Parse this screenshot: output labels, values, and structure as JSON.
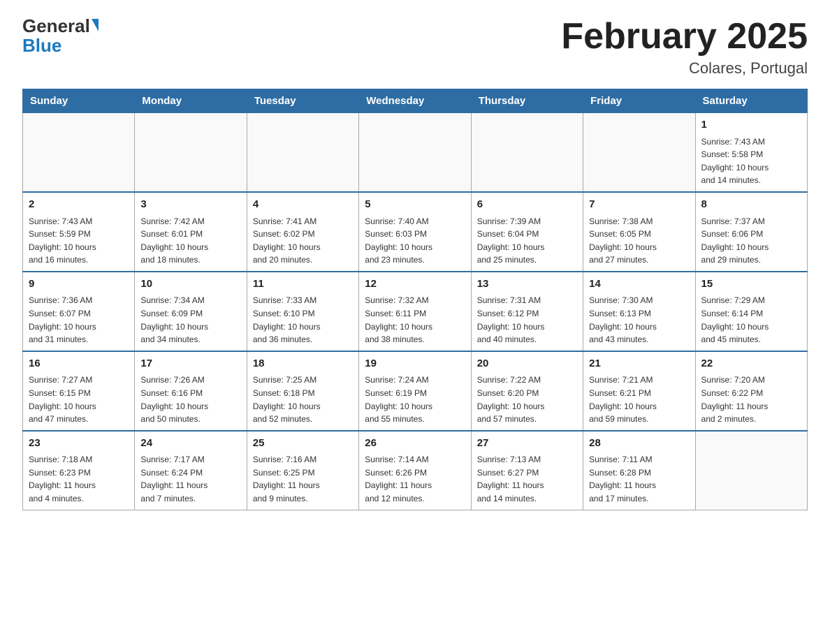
{
  "logo": {
    "general": "General",
    "blue": "Blue"
  },
  "header": {
    "title": "February 2025",
    "location": "Colares, Portugal"
  },
  "weekdays": [
    "Sunday",
    "Monday",
    "Tuesday",
    "Wednesday",
    "Thursday",
    "Friday",
    "Saturday"
  ],
  "weeks": [
    [
      {
        "day": "",
        "info": ""
      },
      {
        "day": "",
        "info": ""
      },
      {
        "day": "",
        "info": ""
      },
      {
        "day": "",
        "info": ""
      },
      {
        "day": "",
        "info": ""
      },
      {
        "day": "",
        "info": ""
      },
      {
        "day": "1",
        "info": "Sunrise: 7:43 AM\nSunset: 5:58 PM\nDaylight: 10 hours\nand 14 minutes."
      }
    ],
    [
      {
        "day": "2",
        "info": "Sunrise: 7:43 AM\nSunset: 5:59 PM\nDaylight: 10 hours\nand 16 minutes."
      },
      {
        "day": "3",
        "info": "Sunrise: 7:42 AM\nSunset: 6:01 PM\nDaylight: 10 hours\nand 18 minutes."
      },
      {
        "day": "4",
        "info": "Sunrise: 7:41 AM\nSunset: 6:02 PM\nDaylight: 10 hours\nand 20 minutes."
      },
      {
        "day": "5",
        "info": "Sunrise: 7:40 AM\nSunset: 6:03 PM\nDaylight: 10 hours\nand 23 minutes."
      },
      {
        "day": "6",
        "info": "Sunrise: 7:39 AM\nSunset: 6:04 PM\nDaylight: 10 hours\nand 25 minutes."
      },
      {
        "day": "7",
        "info": "Sunrise: 7:38 AM\nSunset: 6:05 PM\nDaylight: 10 hours\nand 27 minutes."
      },
      {
        "day": "8",
        "info": "Sunrise: 7:37 AM\nSunset: 6:06 PM\nDaylight: 10 hours\nand 29 minutes."
      }
    ],
    [
      {
        "day": "9",
        "info": "Sunrise: 7:36 AM\nSunset: 6:07 PM\nDaylight: 10 hours\nand 31 minutes."
      },
      {
        "day": "10",
        "info": "Sunrise: 7:34 AM\nSunset: 6:09 PM\nDaylight: 10 hours\nand 34 minutes."
      },
      {
        "day": "11",
        "info": "Sunrise: 7:33 AM\nSunset: 6:10 PM\nDaylight: 10 hours\nand 36 minutes."
      },
      {
        "day": "12",
        "info": "Sunrise: 7:32 AM\nSunset: 6:11 PM\nDaylight: 10 hours\nand 38 minutes."
      },
      {
        "day": "13",
        "info": "Sunrise: 7:31 AM\nSunset: 6:12 PM\nDaylight: 10 hours\nand 40 minutes."
      },
      {
        "day": "14",
        "info": "Sunrise: 7:30 AM\nSunset: 6:13 PM\nDaylight: 10 hours\nand 43 minutes."
      },
      {
        "day": "15",
        "info": "Sunrise: 7:29 AM\nSunset: 6:14 PM\nDaylight: 10 hours\nand 45 minutes."
      }
    ],
    [
      {
        "day": "16",
        "info": "Sunrise: 7:27 AM\nSunset: 6:15 PM\nDaylight: 10 hours\nand 47 minutes."
      },
      {
        "day": "17",
        "info": "Sunrise: 7:26 AM\nSunset: 6:16 PM\nDaylight: 10 hours\nand 50 minutes."
      },
      {
        "day": "18",
        "info": "Sunrise: 7:25 AM\nSunset: 6:18 PM\nDaylight: 10 hours\nand 52 minutes."
      },
      {
        "day": "19",
        "info": "Sunrise: 7:24 AM\nSunset: 6:19 PM\nDaylight: 10 hours\nand 55 minutes."
      },
      {
        "day": "20",
        "info": "Sunrise: 7:22 AM\nSunset: 6:20 PM\nDaylight: 10 hours\nand 57 minutes."
      },
      {
        "day": "21",
        "info": "Sunrise: 7:21 AM\nSunset: 6:21 PM\nDaylight: 10 hours\nand 59 minutes."
      },
      {
        "day": "22",
        "info": "Sunrise: 7:20 AM\nSunset: 6:22 PM\nDaylight: 11 hours\nand 2 minutes."
      }
    ],
    [
      {
        "day": "23",
        "info": "Sunrise: 7:18 AM\nSunset: 6:23 PM\nDaylight: 11 hours\nand 4 minutes."
      },
      {
        "day": "24",
        "info": "Sunrise: 7:17 AM\nSunset: 6:24 PM\nDaylight: 11 hours\nand 7 minutes."
      },
      {
        "day": "25",
        "info": "Sunrise: 7:16 AM\nSunset: 6:25 PM\nDaylight: 11 hours\nand 9 minutes."
      },
      {
        "day": "26",
        "info": "Sunrise: 7:14 AM\nSunset: 6:26 PM\nDaylight: 11 hours\nand 12 minutes."
      },
      {
        "day": "27",
        "info": "Sunrise: 7:13 AM\nSunset: 6:27 PM\nDaylight: 11 hours\nand 14 minutes."
      },
      {
        "day": "28",
        "info": "Sunrise: 7:11 AM\nSunset: 6:28 PM\nDaylight: 11 hours\nand 17 minutes."
      },
      {
        "day": "",
        "info": ""
      }
    ]
  ]
}
